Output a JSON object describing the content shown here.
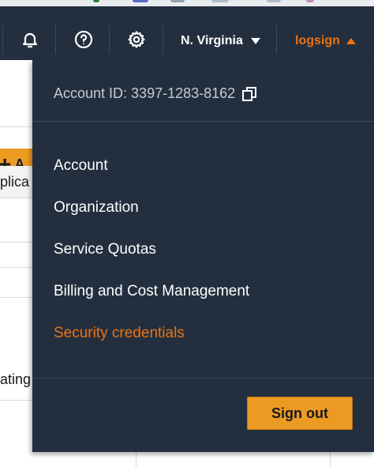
{
  "navbar": {
    "icons": [
      "bell-icon",
      "help-icon",
      "gear-icon"
    ],
    "region": "N. Virginia",
    "username": "logsign"
  },
  "background_page": {
    "add_button_fragment": "A",
    "header_fragment": "plica",
    "row_fragment": "ating"
  },
  "dropdown": {
    "account_label": "Account ID: 3397-1283-8162",
    "menu_items": [
      "Account",
      "Organization",
      "Service Quotas",
      "Billing and Cost Management",
      "Security credentials"
    ],
    "active_item": "Security credentials",
    "sign_out_label": "Sign out"
  },
  "colors": {
    "navbar_bg": "#232f3e",
    "accent_orange": "#ec7211",
    "button_orange": "#ec9a21"
  }
}
